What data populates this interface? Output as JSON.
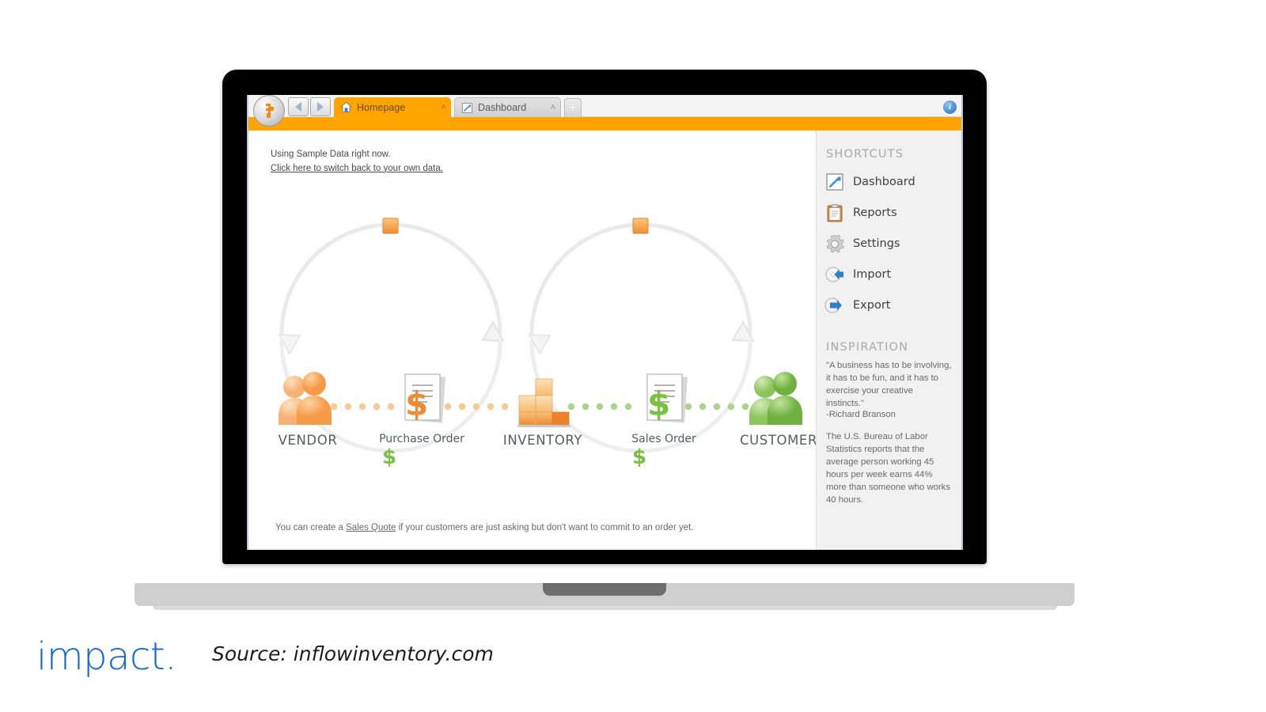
{
  "app": {
    "tabs": [
      {
        "label": "Homepage",
        "icon": "home-icon",
        "active": true,
        "close": "˄"
      },
      {
        "label": "Dashboard",
        "icon": "dashboard-icon",
        "active": false,
        "close": "˄"
      }
    ],
    "new_tab_label": "+",
    "help_icon_glyph": "i",
    "colors": {
      "accent_orange": "#ffa400",
      "sidebar_bg": "#f1f1f1",
      "green": "#7ac143",
      "blue": "#1368ce"
    }
  },
  "notice": {
    "line1": "Using Sample Data right now.",
    "link": "Click here to switch back to your own data."
  },
  "workflow": {
    "nodes": [
      {
        "id": "vendor",
        "label": "VENDOR",
        "style": "primary",
        "art": "people-orange-icon"
      },
      {
        "id": "purchase_order",
        "label": "Purchase Order",
        "style": "secondary",
        "art": "document-dollar-orange-icon"
      },
      {
        "id": "inventory",
        "label": "INVENTORY",
        "style": "primary",
        "art": "boxes-orange-icon"
      },
      {
        "id": "sales_order",
        "label": "Sales Order",
        "style": "secondary",
        "art": "document-dollar-green-icon"
      },
      {
        "id": "customer",
        "label": "CUSTOMER",
        "style": "primary",
        "art": "people-green-icon"
      }
    ],
    "arc_markers": {
      "top_left": "orange-square",
      "top_right": "orange-square",
      "bottom_left": "green-dollar",
      "bottom_right": "green-dollar",
      "dollar_glyph": "$"
    }
  },
  "sidebar": {
    "shortcuts_heading": "SHORTCUTS",
    "shortcuts": [
      {
        "label": "Dashboard",
        "icon": "chart-arrow-icon"
      },
      {
        "label": "Reports",
        "icon": "clipboard-icon"
      },
      {
        "label": "Settings",
        "icon": "gear-icon"
      },
      {
        "label": "Import",
        "icon": "import-disc-icon"
      },
      {
        "label": "Export",
        "icon": "export-disc-icon"
      }
    ],
    "inspiration_heading": "INSPIRATION",
    "quote": "\"A business has to be involving, it has to be fun, and it has to exercise your creative instincts.\"",
    "quote_attribution": "-Richard Branson",
    "fact": "The U.S. Bureau of Labor Statistics reports that the average person working 45 hours per week earns 44% more than someone who works 40 hours."
  },
  "footer": {
    "note_before": "You can create a ",
    "note_link": "Sales Quote",
    "note_after": " if your customers are just asking but don't want to commit to an order yet."
  },
  "caption": {
    "brand": "impact.",
    "source": "Source: inflowinventory.com"
  }
}
